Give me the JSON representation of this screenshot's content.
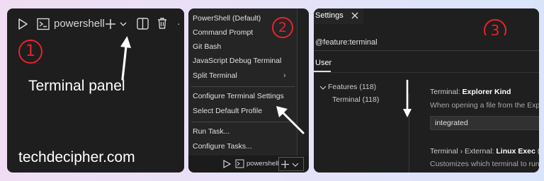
{
  "panel1": {
    "terminal_name": "powershell",
    "step": "1",
    "annotation": "Terminal panel",
    "brand": "techdecipher.com"
  },
  "panel2": {
    "step": "2",
    "menu": [
      "PowerShell (Default)",
      "Command Prompt",
      "Git Bash",
      "JavaScript Debug Terminal",
      "Split Terminal",
      "Configure Terminal Settings",
      "Select Default Profile",
      "Run Task...",
      "Configure Tasks..."
    ],
    "terminal_name": "powershell"
  },
  "panel3": {
    "step": "3",
    "tab": "Settings",
    "search_value": "@feature:terminal",
    "scope_tab": "User",
    "tree": {
      "features": "Features (118)",
      "terminal": "Terminal (118)"
    },
    "setting1": {
      "prefix": "Terminal: ",
      "name": "Explorer Kind",
      "desc": "When opening a file from the Exp",
      "value": "integrated"
    },
    "setting2": {
      "prefix": "Terminal › External: ",
      "name": "Linux Exec",
      "suffix": "(A",
      "desc": "Customizes which terminal to run"
    }
  },
  "colors": {
    "annotation_red": "#e8232a",
    "dark_bg": "#1e1e1e"
  }
}
